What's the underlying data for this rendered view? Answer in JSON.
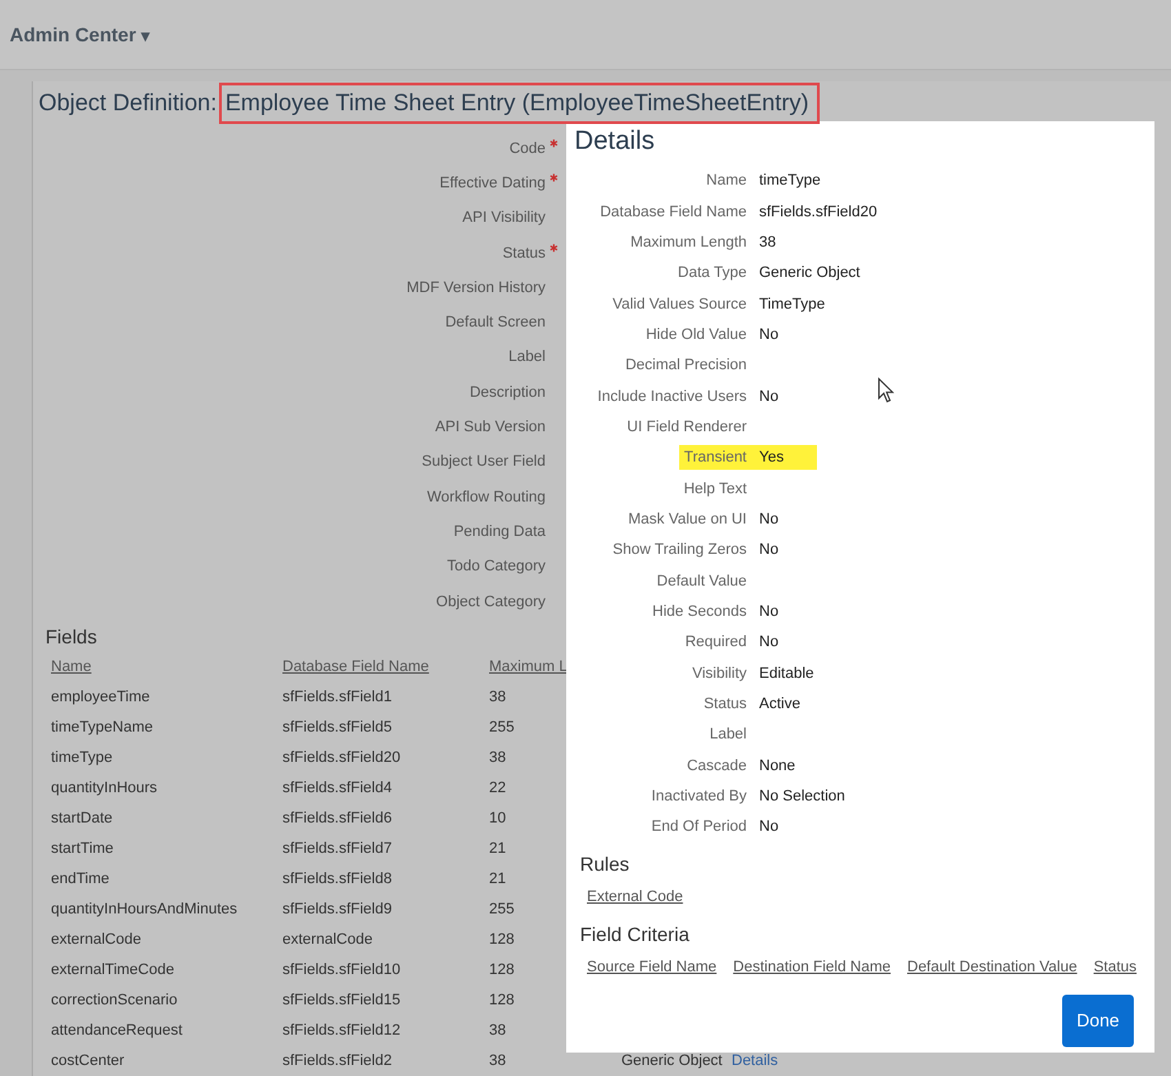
{
  "header": {
    "title": "Admin Center",
    "caret": "▾"
  },
  "object_definition": {
    "prefix": "Object Definition:",
    "name": "Employee Time Sheet Entry (EmployeeTimeSheetEntry)",
    "highlighted": true
  },
  "form_labels": [
    {
      "label": "Code",
      "required": true
    },
    {
      "label": "Effective Dating",
      "required": true
    },
    {
      "label": "API Visibility",
      "required": false
    },
    {
      "label": "Status",
      "required": true
    },
    {
      "label": "MDF Version History",
      "required": false
    },
    {
      "label": "Default Screen",
      "required": false
    },
    {
      "label": "Label",
      "required": false
    },
    {
      "label": "Description",
      "required": false
    },
    {
      "label": "API Sub Version",
      "required": false
    },
    {
      "label": "Subject User Field",
      "required": false
    },
    {
      "label": "Workflow Routing",
      "required": false
    },
    {
      "label": "Pending Data",
      "required": false
    },
    {
      "label": "Todo Category",
      "required": false
    },
    {
      "label": "Object Category",
      "required": false
    }
  ],
  "fields": {
    "title": "Fields",
    "columns": [
      "Name",
      "Database Field Name",
      "Maximum L"
    ],
    "rows": [
      {
        "name": "employeeTime",
        "db": "sfFields.sfField1",
        "max": "38"
      },
      {
        "name": "timeTypeName",
        "db": "sfFields.sfField5",
        "max": "255"
      },
      {
        "name": "timeType",
        "db": "sfFields.sfField20",
        "max": "38"
      },
      {
        "name": "quantityInHours",
        "db": "sfFields.sfField4",
        "max": "22"
      },
      {
        "name": "startDate",
        "db": "sfFields.sfField6",
        "max": "10"
      },
      {
        "name": "startTime",
        "db": "sfFields.sfField7",
        "max": "21"
      },
      {
        "name": "endTime",
        "db": "sfFields.sfField8",
        "max": "21"
      },
      {
        "name": "quantityInHoursAndMinutes",
        "db": "sfFields.sfField9",
        "max": "255"
      },
      {
        "name": "externalCode",
        "db": "externalCode",
        "max": "128"
      },
      {
        "name": "externalTimeCode",
        "db": "sfFields.sfField10",
        "max": "128"
      },
      {
        "name": "correctionScenario",
        "db": "sfFields.sfField15",
        "max": "128"
      },
      {
        "name": "attendanceRequest",
        "db": "sfFields.sfField12",
        "max": "38"
      },
      {
        "name": "costCenter",
        "db": "sfFields.sfField2",
        "max": "38",
        "data_type": "Generic Object",
        "link": "Details"
      }
    ]
  },
  "details": {
    "title": "Details",
    "rows": [
      {
        "label": "Name",
        "value": "timeType",
        "highlighted": false
      },
      {
        "label": "Database Field Name",
        "value": "sfFields.sfField20",
        "highlighted": false
      },
      {
        "label": "Maximum Length",
        "value": "38",
        "highlighted": false
      },
      {
        "label": "Data Type",
        "value": "Generic Object",
        "highlighted": false
      },
      {
        "label": "Valid Values Source",
        "value": "TimeType",
        "highlighted": false
      },
      {
        "label": "Hide Old Value",
        "value": "No",
        "highlighted": false
      },
      {
        "label": "Decimal Precision",
        "highlighted": false
      },
      {
        "label": "Include Inactive Users",
        "value": "No",
        "highlighted": false
      },
      {
        "label": "UI Field Renderer",
        "highlighted": false
      },
      {
        "label": "Transient",
        "value": "Yes",
        "highlighted": true
      },
      {
        "label": "Help Text",
        "highlighted": false
      },
      {
        "label": "Mask Value on UI",
        "value": "No",
        "highlighted": false
      },
      {
        "label": "Show Trailing Zeros",
        "value": "No",
        "highlighted": false
      },
      {
        "label": "Default Value",
        "highlighted": false
      },
      {
        "label": "Hide Seconds",
        "value": "No",
        "highlighted": false
      },
      {
        "label": "Required",
        "value": "No",
        "highlighted": false
      },
      {
        "label": "Visibility",
        "value": "Editable",
        "highlighted": false
      },
      {
        "label": "Status",
        "value": "Active",
        "highlighted": false
      },
      {
        "label": "Label",
        "highlighted": false
      },
      {
        "label": "Cascade",
        "value": "None",
        "highlighted": false
      },
      {
        "label": "Inactivated By",
        "value": "No Selection",
        "highlighted": false
      },
      {
        "label": "End Of Period",
        "value": "No",
        "highlighted": false
      }
    ],
    "rules_title": "Rules",
    "rules": [
      "External Code"
    ],
    "criteria_title": "Field Criteria",
    "criteria_columns": [
      "Source Field Name",
      "Destination Field Name",
      "Default Destination Value",
      "Status"
    ],
    "done": "Done"
  }
}
